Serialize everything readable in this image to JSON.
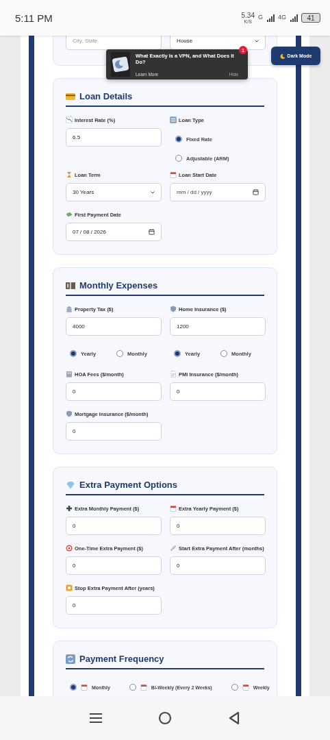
{
  "status_bar": {
    "time": "5:11 PM",
    "speed": "5.34",
    "speed_unit": "K/S",
    "network_1": "G",
    "network_2": "4G",
    "battery": "41"
  },
  "top_card": {
    "fields": [
      {
        "kind": "text",
        "placeholder": "City, State"
      },
      {
        "kind": "select",
        "value": "House"
      }
    ]
  },
  "toast": {
    "title": "What Exactly Is a VPN, and What Does It Do?",
    "action": "Learn More",
    "dismiss": "Hide",
    "badge": "1"
  },
  "dark_mode_button": {
    "label": "Dark Mode"
  },
  "sections": [
    {
      "title": "Loan Details",
      "fields": [
        {
          "kind": "text",
          "label": "Interest Rate (%)",
          "value": "6.5"
        },
        {
          "kind": "radio_column",
          "label": "Loan Type",
          "options": [
            {
              "label": "Fixed Rate",
              "selected": true
            },
            {
              "label": "Adjustable (ARM)",
              "selected": false
            }
          ]
        },
        {
          "kind": "select",
          "label": "Loan Term",
          "value": "30 Years"
        },
        {
          "kind": "date",
          "label": "Loan Start Date",
          "placeholder": "mm / dd / yyyy"
        },
        {
          "kind": "date",
          "label": "First Payment Date",
          "value": "07 / 08 / 2026"
        }
      ]
    },
    {
      "title": "Monthly Expenses",
      "fields": [
        {
          "kind": "text",
          "label": "Property Tax ($)",
          "value": "4000",
          "options": [
            {
              "label": "Yearly",
              "selected": true
            },
            {
              "label": "Monthly",
              "selected": false
            }
          ]
        },
        {
          "kind": "text",
          "label": "Home Insurance ($)",
          "value": "1200",
          "options": [
            {
              "label": "Yearly",
              "selected": true
            },
            {
              "label": "Monthly",
              "selected": false
            }
          ]
        },
        {
          "kind": "text",
          "label": "HOA Fees ($/month)",
          "value": "0"
        },
        {
          "kind": "text",
          "label": "PMI Insurance ($/month)",
          "value": "0"
        },
        {
          "kind": "text",
          "label": "Mortgage Insurance ($/month)",
          "value": "0"
        }
      ]
    },
    {
      "title": "Extra Payment Options",
      "fields": [
        {
          "kind": "text",
          "label": "Extra Monthly Payment ($)",
          "value": "0"
        },
        {
          "kind": "text",
          "label": "Extra Yearly Payment ($)",
          "value": "0"
        },
        {
          "kind": "text",
          "label": "One-Time Extra Payment ($)",
          "value": "0"
        },
        {
          "kind": "text",
          "label": "Start Extra Payment After (months)",
          "value": "0"
        },
        {
          "kind": "text",
          "label": "Stop Extra Payment After (years)",
          "value": "0"
        }
      ]
    },
    {
      "title": "Payment Frequency",
      "fields": [
        {
          "kind": "radio_row",
          "options": [
            {
              "label": "Monthly",
              "selected": true
            },
            {
              "label": "Bi-Weekly (Every 2 Weeks)",
              "selected": false
            },
            {
              "label": "Weekly",
              "selected": false
            }
          ]
        }
      ]
    }
  ]
}
